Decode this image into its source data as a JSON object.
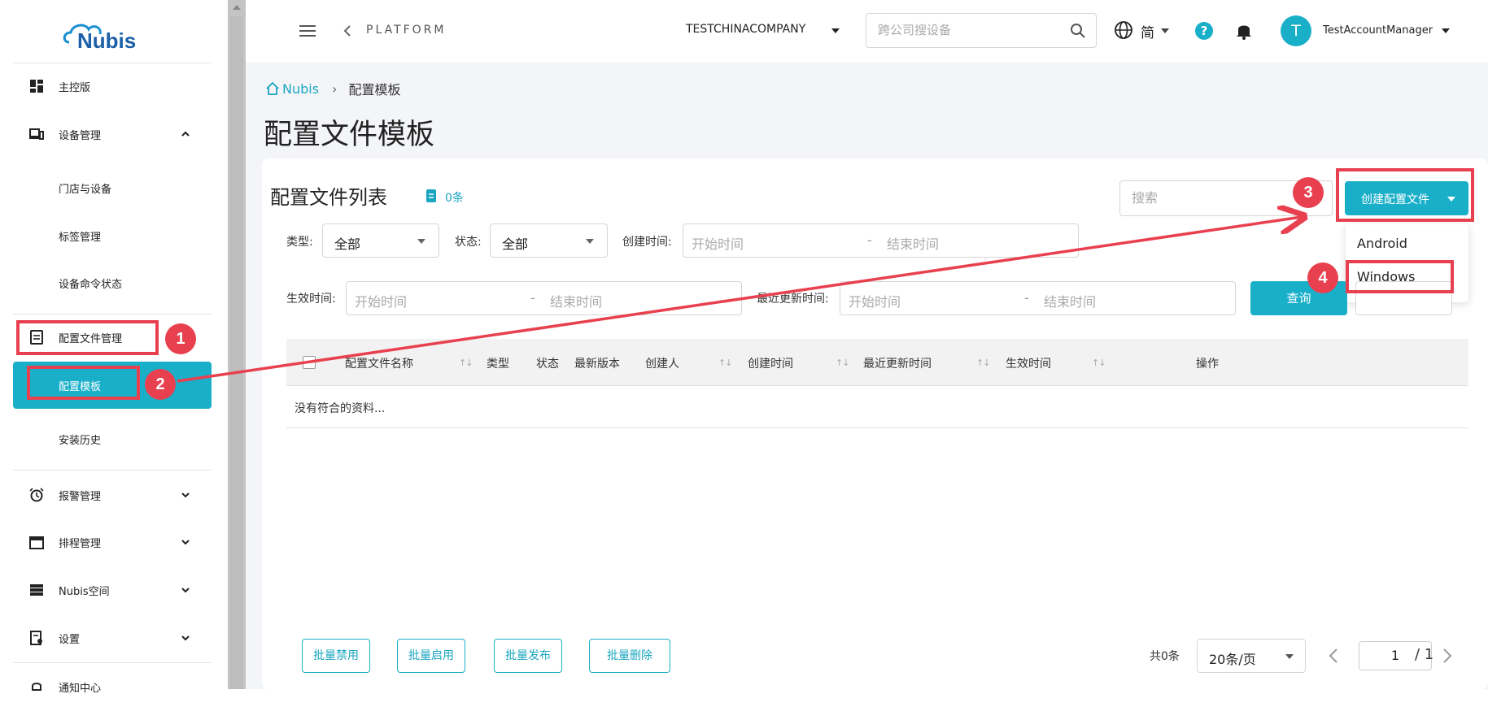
{
  "sidebar": {
    "logo_text": "Nubis",
    "items": {
      "dashboard": "主控版",
      "device_mgmt": "设备管理",
      "stores": "门店与设备",
      "tags": "标签管理",
      "cmd_status": "设备命令状态",
      "config_mgmt": "配置文件管理",
      "config_template": "配置模板",
      "install_history": "安装历史",
      "alarm": "报警管理",
      "schedule": "排程管理",
      "space": "Nubis空间",
      "settings": "设置",
      "notifications": "通知中心"
    }
  },
  "topbar": {
    "platform": "PLATFORM",
    "company": "TESTCHINACOMPANY",
    "search_placeholder": "跨公司搜设备",
    "lang": "简",
    "avatar_letter": "T",
    "username": "TestAccountManager"
  },
  "breadcrumb": {
    "root": "Nubis",
    "current": "配置模板"
  },
  "page_title": "配置文件模板",
  "list": {
    "title": "配置文件列表",
    "count": "0条",
    "search_placeholder": "搜索",
    "create_button": "创建配置文件",
    "dropdown": {
      "android": "Android",
      "windows": "Windows"
    }
  },
  "filters": {
    "type_label": "类型:",
    "type_value": "全部",
    "status_label": "状态:",
    "status_value": "全部",
    "created_label": "创建时间:",
    "effective_label": "生效时间:",
    "updated_label": "最近更新时间:",
    "start_placeholder": "开始时间",
    "end_placeholder": "结束时间",
    "dash": "-",
    "query": "查询"
  },
  "table": {
    "columns": {
      "name": "配置文件名称",
      "type": "类型",
      "status": "状态",
      "version": "最新版本",
      "creator": "创建人",
      "created": "创建时间",
      "updated": "最近更新时间",
      "effective": "生效时间",
      "action": "操作"
    },
    "sort_glyph": "↑↓",
    "empty": "没有符合的资料..."
  },
  "bulk": {
    "disable": "批量禁用",
    "enable": "批量启用",
    "publish": "批量发布",
    "delete": "批量删除"
  },
  "pagination": {
    "total": "共0条",
    "page_size": "20条/页",
    "page": "1",
    "of": "/ 1"
  },
  "annotations": {
    "b1": "1",
    "b2": "2",
    "b3": "3",
    "b4": "4"
  },
  "colors": {
    "accent": "#1aafc9",
    "annotation": "#e8404f"
  }
}
